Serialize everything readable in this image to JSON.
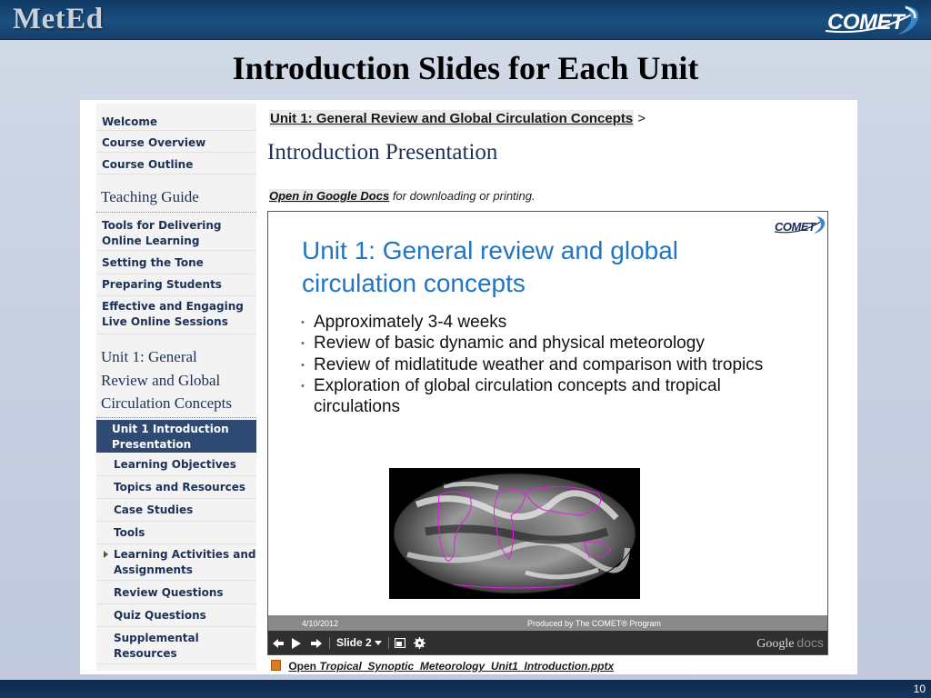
{
  "header": {
    "meted_logo": "MetEd",
    "comet_logo": "COMET"
  },
  "slide": {
    "title": "Introduction Slides for Each Unit",
    "page_number": "10"
  },
  "sidebar": {
    "top_links": [
      "Welcome",
      "Course Overview",
      "Course Outline"
    ],
    "teaching_guide_heading": "Teaching Guide",
    "teaching_guide_items": [
      [
        "Tools for Delivering",
        "Online Learning"
      ],
      [
        "Setting the Tone"
      ],
      [
        "Preparing Students"
      ],
      [
        "Effective and Engaging",
        "Live Online Sessions"
      ]
    ],
    "unit_heading_lines": [
      "Unit 1: General",
      "Review and Global",
      "Circulation Concepts"
    ],
    "active_item_lines": [
      "Unit 1 Introduction",
      "Presentation"
    ],
    "unit_items": [
      [
        "Learning Objectives"
      ],
      [
        "Topics and Resources"
      ],
      [
        "Case Studies"
      ],
      [
        "Tools"
      ],
      [
        "Learning Activities and",
        "Assignments"
      ],
      [
        "Review Questions"
      ],
      [
        "Quiz Questions"
      ],
      [
        "Supplemental",
        "Resources"
      ]
    ]
  },
  "main": {
    "breadcrumb_link": "Unit 1: General Review and Global Circulation Concepts",
    "breadcrumb_sep": ">",
    "heading": "Introduction Presentation",
    "open_link": "Open in Google Docs",
    "open_rest": "for downloading or printing.",
    "file_link_prefix": "Open",
    "file_link_name": "Tropical_Synoptic_Meteorology_Unit1_Introduction.pptx"
  },
  "embed": {
    "logo": "COMET",
    "title": "Unit 1: General review and global circulation concepts",
    "bullets": [
      "Approximately 3-4 weeks",
      "Review of basic dynamic and physical meteorology",
      "Review of midlatitude weather and comparison with tropics",
      "Exploration of global circulation concepts and tropical circulations"
    ],
    "footer_date": "4/10/2012",
    "footer_producer": "Produced by The COMET® Program",
    "slide_selector": "Slide 2",
    "brand_google": "Google",
    "brand_docs": "docs"
  },
  "colors": {
    "header_navy": "#1a4f80",
    "sidebar_active": "#2e4a72",
    "slide_title_blue": "#1f75c6",
    "world_map_outline": "#e020e0"
  },
  "icons": [
    "prev-slide-icon",
    "play-icon",
    "next-slide-icon",
    "dropdown-caret-icon",
    "popout-icon",
    "gear-icon",
    "pptx-file-icon",
    "expand-arrow-icon"
  ]
}
